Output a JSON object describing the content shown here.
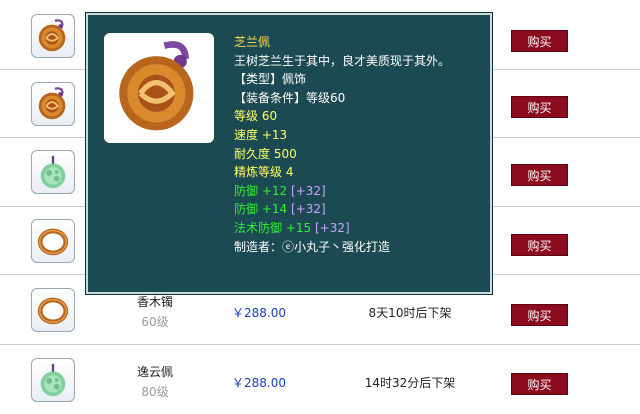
{
  "colors": {
    "price": "#1d3fb5",
    "buy_button": "#8b0b1f",
    "tooltip_bg": "#1c4a52",
    "stat_yellow": "#ffff66",
    "stat_green": "#33ee33",
    "bonus_purple": "#c9a4ff"
  },
  "rows": [
    {
      "icon": "amulet-icon",
      "name": "",
      "level": "",
      "price": "",
      "time": "",
      "buy_label": "购买"
    },
    {
      "icon": "amulet-icon",
      "name": "",
      "level": "",
      "price": "",
      "time": "",
      "buy_label": "购买"
    },
    {
      "icon": "jade-pendant-icon",
      "name": "",
      "level": "",
      "price": "",
      "time": "",
      "buy_label": "购买"
    },
    {
      "icon": "bracelet-icon",
      "name": "",
      "level": "",
      "price": "",
      "time": "",
      "buy_label": "购买"
    },
    {
      "icon": "bracelet-icon",
      "name": "香木镯",
      "level": "60级",
      "price": "￥288.00",
      "time": "8天10时后下架",
      "buy_label": "购买"
    },
    {
      "icon": "jade-pendant-icon",
      "name": "逸云佩",
      "level": "80级",
      "price": "￥288.00",
      "time": "14时32分后下架",
      "buy_label": "购买"
    }
  ],
  "tooltip": {
    "image_icon": "amulet-icon",
    "title": "芝兰佩",
    "description": "王树芝兰生于其中，良才美质现于其外。",
    "type_line": "【类型】佩饰",
    "requirement_line": "【装备条件】等级60",
    "level": "等级 60",
    "speed": "速度 +13",
    "durability": "耐久度 500",
    "refine": "精炼等级 4",
    "defense1": "防御 +12",
    "defense1_bonus": "[+32]",
    "defense2": "防御 +14",
    "defense2_bonus": "[+32]",
    "magic_defense": "法术防御 +15",
    "magic_defense_bonus": "[+32]",
    "maker": "制造者：ⓔ小丸子丶强化打造"
  }
}
